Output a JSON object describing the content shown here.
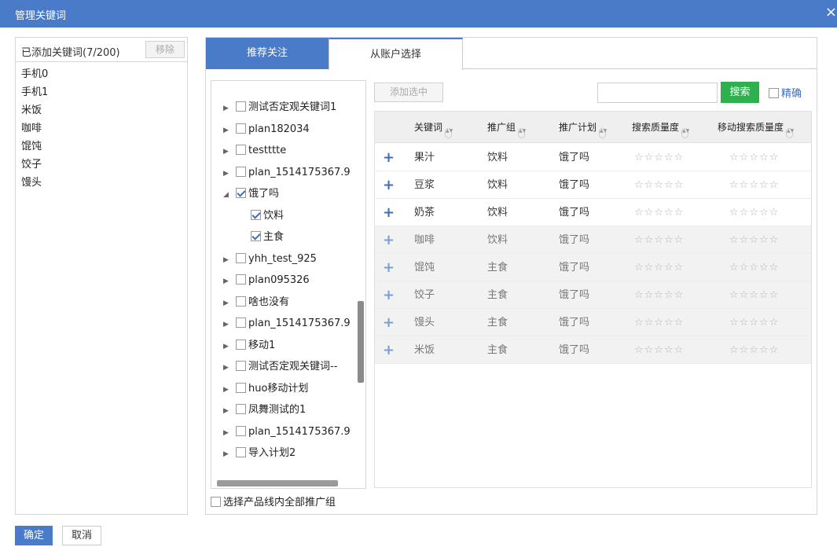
{
  "dialog": {
    "title": "管理关键词",
    "close_glyph": "×"
  },
  "left": {
    "count_label": "已添加关键词(7/200)",
    "remove_label": "移除",
    "items": [
      "手机0",
      "手机1",
      "米饭",
      "咖啡",
      "馄饨",
      "饺子",
      "馒头"
    ]
  },
  "tabs": {
    "recommend": "推荐关注",
    "account": "从账户选择"
  },
  "tree": [
    {
      "label": "测试否定观关键词1",
      "arrow": "▶",
      "checked": false,
      "indent": 0
    },
    {
      "label": "plan182034",
      "arrow": "▶",
      "checked": false,
      "indent": 0
    },
    {
      "label": "testttte",
      "arrow": "▶",
      "checked": false,
      "indent": 0
    },
    {
      "label": "plan_1514175367.9",
      "arrow": "▶",
      "checked": false,
      "indent": 0
    },
    {
      "label": "饿了吗",
      "arrow": "◢",
      "checked": true,
      "indent": 0
    },
    {
      "label": "饮料",
      "arrow": "",
      "checked": true,
      "indent": 1
    },
    {
      "label": "主食",
      "arrow": "",
      "checked": true,
      "indent": 1
    },
    {
      "label": "yhh_test_925",
      "arrow": "▶",
      "checked": false,
      "indent": 0
    },
    {
      "label": "plan095326",
      "arrow": "▶",
      "checked": false,
      "indent": 0
    },
    {
      "label": "啥也没有",
      "arrow": "▶",
      "checked": false,
      "indent": 0
    },
    {
      "label": "plan_1514175367.9",
      "arrow": "▶",
      "checked": false,
      "indent": 0
    },
    {
      "label": "移动1",
      "arrow": "▶",
      "checked": false,
      "indent": 0
    },
    {
      "label": "测试否定观关键词--",
      "arrow": "▶",
      "checked": false,
      "indent": 0
    },
    {
      "label": "huo移动计划",
      "arrow": "▶",
      "checked": false,
      "indent": 0
    },
    {
      "label": "凤舞测试的1",
      "arrow": "▶",
      "checked": false,
      "indent": 0
    },
    {
      "label": "plan_1514175367.9",
      "arrow": "▶",
      "checked": false,
      "indent": 0
    },
    {
      "label": "导入计划2",
      "arrow": "▶",
      "checked": false,
      "indent": 0
    }
  ],
  "select_all_label": "选择产品线内全部推广组",
  "toolbar": {
    "add_selected": "添加选中",
    "search_value": "",
    "search_btn": "搜索",
    "exact_label": "精确"
  },
  "table": {
    "headers": [
      "关键词",
      "推广组",
      "推广计划",
      "搜索质量度",
      "移动搜索质量度"
    ],
    "rows": [
      {
        "keyword": "果汁",
        "group": "饮料",
        "plan": "饿了吗",
        "q": "☆☆☆☆☆",
        "mq": "☆☆☆☆☆",
        "added": false
      },
      {
        "keyword": "豆浆",
        "group": "饮料",
        "plan": "饿了吗",
        "q": "☆☆☆☆☆",
        "mq": "☆☆☆☆☆",
        "added": false
      },
      {
        "keyword": "奶茶",
        "group": "饮料",
        "plan": "饿了吗",
        "q": "☆☆☆☆☆",
        "mq": "☆☆☆☆☆",
        "added": false
      },
      {
        "keyword": "咖啡",
        "group": "饮料",
        "plan": "饿了吗",
        "q": "☆☆☆☆☆",
        "mq": "☆☆☆☆☆",
        "added": true
      },
      {
        "keyword": "馄饨",
        "group": "主食",
        "plan": "饿了吗",
        "q": "☆☆☆☆☆",
        "mq": "☆☆☆☆☆",
        "added": true
      },
      {
        "keyword": "饺子",
        "group": "主食",
        "plan": "饿了吗",
        "q": "☆☆☆☆☆",
        "mq": "☆☆☆☆☆",
        "added": true
      },
      {
        "keyword": "馒头",
        "group": "主食",
        "plan": "饿了吗",
        "q": "☆☆☆☆☆",
        "mq": "☆☆☆☆☆",
        "added": true
      },
      {
        "keyword": "米饭",
        "group": "主食",
        "plan": "饿了吗",
        "q": "☆☆☆☆☆",
        "mq": "☆☆☆☆☆",
        "added": true
      }
    ]
  },
  "footer": {
    "ok": "确定",
    "cancel": "取消"
  }
}
